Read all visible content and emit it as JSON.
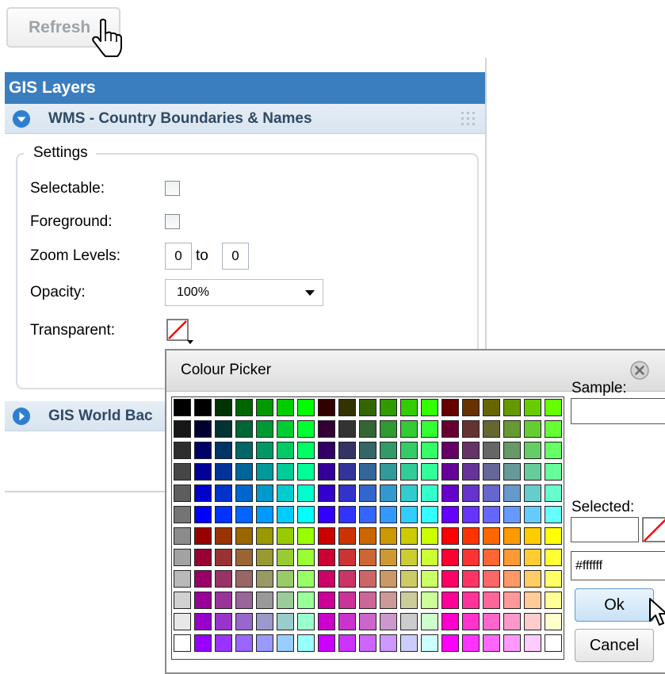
{
  "toolbar": {
    "refresh_label": "Refresh"
  },
  "panel": {
    "title": "GIS Layers",
    "layers": [
      {
        "label": "WMS - Country Boundaries & Names",
        "expanded": true
      },
      {
        "label": "GIS World Bac",
        "expanded": false
      }
    ],
    "settings": {
      "legend": "Settings",
      "selectable_label": "Selectable:",
      "foreground_label": "Foreground:",
      "zoom_label": "Zoom Levels:",
      "zoom_min": "0",
      "zoom_to": "to",
      "zoom_max": "0",
      "opacity_label": "Opacity:",
      "opacity_value": "100%",
      "transparent_label": "Transparent:"
    }
  },
  "picker": {
    "title": "Colour Picker",
    "sample_label": "Sample:",
    "selected_label": "Selected:",
    "hex_value": "#ffffff",
    "ok_label": "Ok",
    "cancel_label": "Cancel",
    "colors": {
      "accent": "#3b7ebf",
      "none_slash": "#ff0000"
    }
  }
}
